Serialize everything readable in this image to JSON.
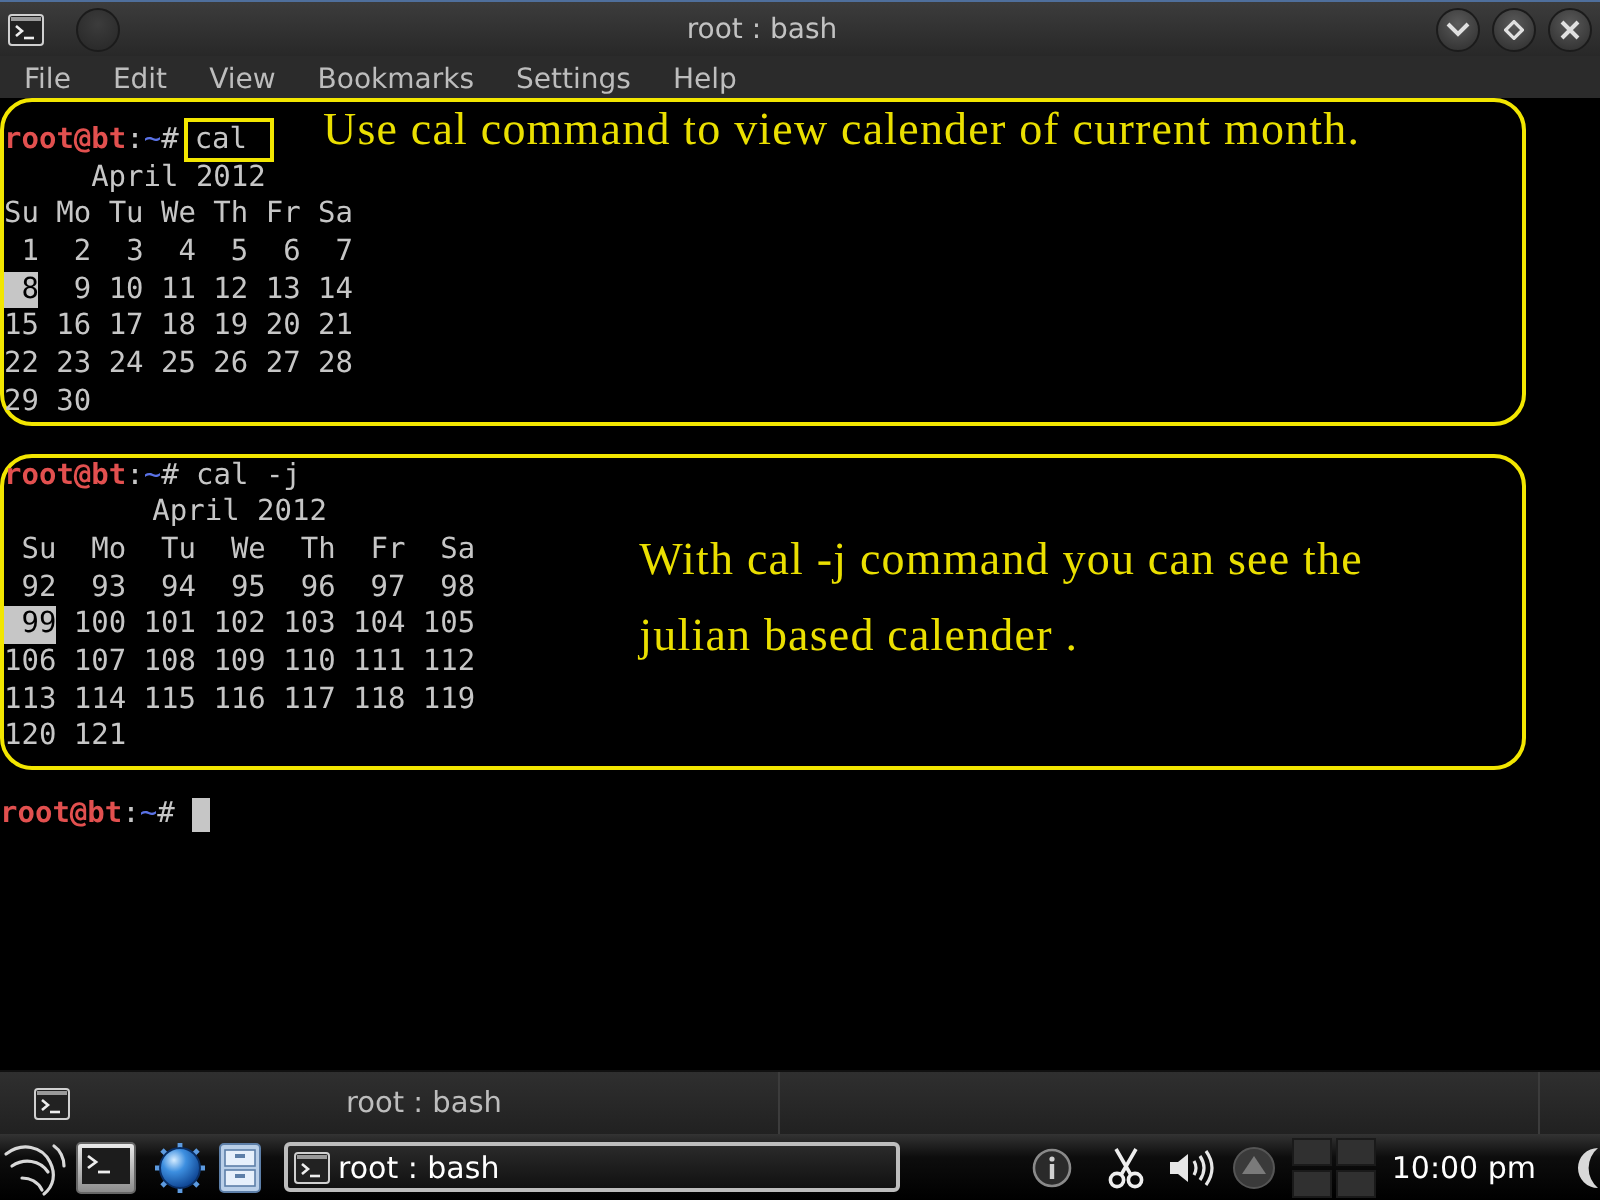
{
  "window": {
    "title": "root : bash"
  },
  "menu": [
    "File",
    "Edit",
    "View",
    "Bookmarks",
    "Settings",
    "Help"
  ],
  "terminal": {
    "blocks": [
      {
        "kind": "inline",
        "prompt": {
          "user_host": "root@bt",
          "separator": ":",
          "cwd": "~",
          "symbol": "#"
        },
        "command": {
          "text": "cal",
          "highlighted": true
        },
        "note": "Use cal command to view calender of current month.",
        "calendar": {
          "kind": "gregorian",
          "title": "April 2012",
          "weekdays": [
            "Su",
            "Mo",
            "Tu",
            "We",
            "Th",
            "Fr",
            "Sa"
          ],
          "weeks": [
            [
              {
                "day": "1",
                "today": false
              },
              {
                "day": "2",
                "today": false
              },
              {
                "day": "3",
                "today": false
              },
              {
                "day": "4",
                "today": false
              },
              {
                "day": "5",
                "today": false
              },
              {
                "day": "6",
                "today": false
              },
              {
                "day": "7",
                "today": false
              }
            ],
            [
              {
                "day": "8",
                "today": true
              },
              {
                "day": "9",
                "today": false
              },
              {
                "day": "10",
                "today": false
              },
              {
                "day": "11",
                "today": false
              },
              {
                "day": "12",
                "today": false
              },
              {
                "day": "13",
                "today": false
              },
              {
                "day": "14",
                "today": false
              }
            ],
            [
              {
                "day": "15",
                "today": false
              },
              {
                "day": "16",
                "today": false
              },
              {
                "day": "17",
                "today": false
              },
              {
                "day": "18",
                "today": false
              },
              {
                "day": "19",
                "today": false
              },
              {
                "day": "20",
                "today": false
              },
              {
                "day": "21",
                "today": false
              }
            ],
            [
              {
                "day": "22",
                "today": false
              },
              {
                "day": "23",
                "today": false
              },
              {
                "day": "24",
                "today": false
              },
              {
                "day": "25",
                "today": false
              },
              {
                "day": "26",
                "today": false
              },
              {
                "day": "27",
                "today": false
              },
              {
                "day": "28",
                "today": false
              }
            ],
            [
              {
                "day": "29",
                "today": false
              },
              {
                "day": "30",
                "today": false
              }
            ]
          ]
        }
      },
      {
        "kind": "beside",
        "prompt": {
          "user_host": "root@bt",
          "separator": ":",
          "cwd": "~",
          "symbol": "#"
        },
        "command": {
          "text": "cal -j",
          "highlighted": false
        },
        "note": "With cal -j command you can see the julian based calender .",
        "calendar": {
          "kind": "julian",
          "title": "April 2012",
          "weekdays": [
            "Su",
            "Mo",
            "Tu",
            "We",
            "Th",
            "Fr",
            "Sa"
          ],
          "weeks": [
            [
              {
                "day": "92",
                "today": false
              },
              {
                "day": "93",
                "today": false
              },
              {
                "day": "94",
                "today": false
              },
              {
                "day": "95",
                "today": false
              },
              {
                "day": "96",
                "today": false
              },
              {
                "day": "97",
                "today": false
              },
              {
                "day": "98",
                "today": false
              }
            ],
            [
              {
                "day": "99",
                "today": true
              },
              {
                "day": "100",
                "today": false
              },
              {
                "day": "101",
                "today": false
              },
              {
                "day": "102",
                "today": false
              },
              {
                "day": "103",
                "today": false
              },
              {
                "day": "104",
                "today": false
              },
              {
                "day": "105",
                "today": false
              }
            ],
            [
              {
                "day": "106",
                "today": false
              },
              {
                "day": "107",
                "today": false
              },
              {
                "day": "108",
                "today": false
              },
              {
                "day": "109",
                "today": false
              },
              {
                "day": "110",
                "today": false
              },
              {
                "day": "111",
                "today": false
              },
              {
                "day": "112",
                "today": false
              }
            ],
            [
              {
                "day": "113",
                "today": false
              },
              {
                "day": "114",
                "today": false
              },
              {
                "day": "115",
                "today": false
              },
              {
                "day": "116",
                "today": false
              },
              {
                "day": "117",
                "today": false
              },
              {
                "day": "118",
                "today": false
              },
              {
                "day": "119",
                "today": false
              }
            ],
            [
              {
                "day": "120",
                "today": false
              },
              {
                "day": "121",
                "today": false
              }
            ]
          ]
        }
      }
    ],
    "prompt": {
      "user_host": "root@bt",
      "separator": ":",
      "cwd": "~",
      "symbol": "#"
    }
  },
  "tab_bar": {
    "tab": "root : bash"
  },
  "taskbar": {
    "tasks": [
      "root : bash"
    ],
    "clock": "10:00 pm"
  }
}
